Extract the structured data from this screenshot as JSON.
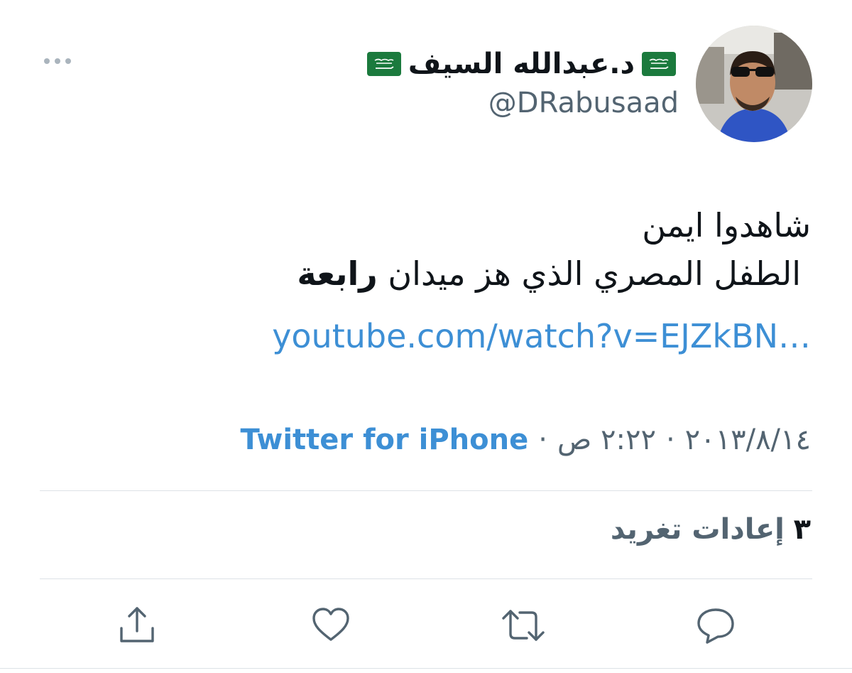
{
  "tweet": {
    "display_name": "د.عبدالله السيف",
    "handle": "@DRabusaad",
    "text_line1": "شاهدوا ايمن",
    "text_line2_regular": "الطفل المصري الذي هز ميدان ",
    "text_line2_bold": "رابعة",
    "link": "youtube.com/watch?v=EJZkBN…",
    "date": "٢٠١٣/٨/١٤",
    "time": "٢:٢٢ ص",
    "separator": "·",
    "source": "Twitter for iPhone",
    "retweet_count": "٣",
    "retweet_label": "إعادات تغريد"
  },
  "icons": {
    "more": "more-horizontal-icon",
    "reply": "reply-icon",
    "retweet": "retweet-icon",
    "like": "heart-icon",
    "share": "share-icon",
    "flag": "saudi-flag-icon"
  },
  "colors": {
    "link": "#3d8fd5",
    "text": "#0f1419",
    "secondary": "#536471",
    "divider": "#dde2e6",
    "flag_green": "#1b7a3d"
  }
}
